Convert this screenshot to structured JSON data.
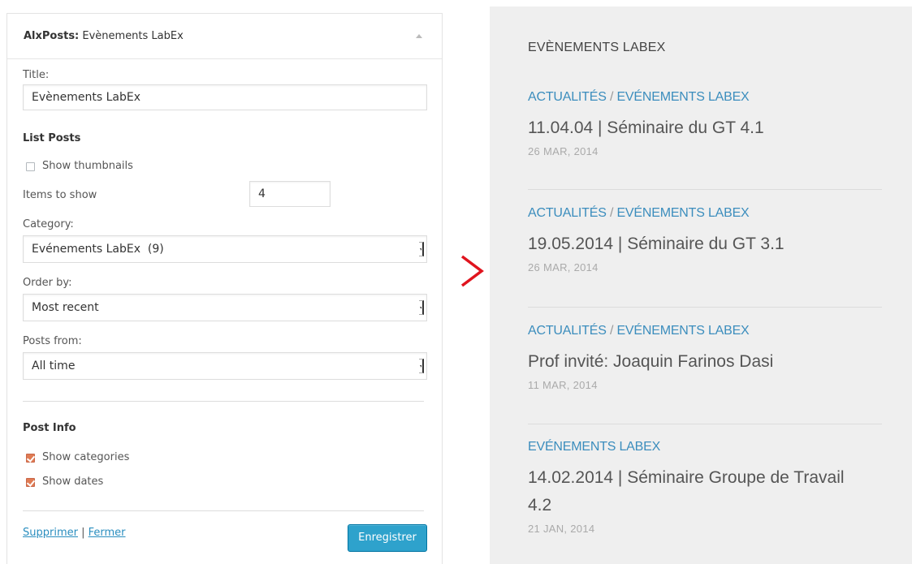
{
  "widget": {
    "title_bold": "AlxPosts:",
    "title_rest": " Evènements LabEx",
    "title_label": "Title:",
    "title_value": "Evènements LabEx",
    "list_posts_heading": "List Posts",
    "show_thumbnails_label": "Show thumbnails",
    "show_thumbnails_checked": false,
    "items_to_show_label": "Items to show",
    "items_to_show_value": "4",
    "category_label": "Category:",
    "category_value": "Evénements LabEx  (9)",
    "order_by_label": "Order by:",
    "order_by_value": "Most recent",
    "posts_from_label": "Posts from:",
    "posts_from_value": "All time",
    "post_info_heading": "Post Info",
    "show_categories_label": "Show categories",
    "show_categories_checked": true,
    "show_dates_label": "Show dates",
    "show_dates_checked": true,
    "delete_link": "Supprimer",
    "link_separator": " | ",
    "close_link": "Fermer",
    "save_button": "Enregistrer"
  },
  "arrow_glyph": ">",
  "colors": {
    "accent_blue": "#2ea2cc",
    "checkbox_orange": "#e07b53",
    "category_blue": "#3b8dbd",
    "arrow_red": "#e0141e"
  },
  "preview": {
    "heading": "EVÈNEMENTS LABEX",
    "posts": [
      {
        "categories": [
          "ACTUALITÉS",
          "EVÉNEMENTS LABEX"
        ],
        "title": "11.04.04 | Séminaire du GT 4.1",
        "date": "26 MAR, 2014"
      },
      {
        "categories": [
          "ACTUALITÉS",
          "EVÉNEMENTS LABEX"
        ],
        "title": "19.05.2014 | Séminaire du GT 3.1",
        "date": "26 MAR, 2014"
      },
      {
        "categories": [
          "ACTUALITÉS",
          "EVÉNEMENTS LABEX"
        ],
        "title": "Prof invité: Joaquin Farinos Dasi",
        "date": "11 MAR, 2014"
      },
      {
        "categories": [
          "EVÉNEMENTS LABEX"
        ],
        "title": "14.02.2014 | Séminaire Groupe de Travail 4.2",
        "date": "21 JAN, 2014"
      }
    ]
  }
}
